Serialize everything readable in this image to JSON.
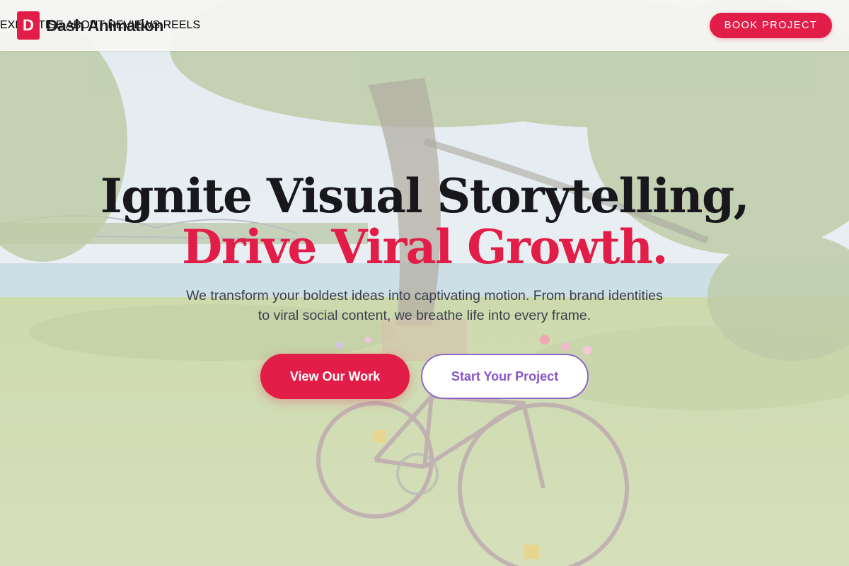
{
  "brand": {
    "logo_letter": "D",
    "name": "Dash Animation",
    "accent": "#e11d48"
  },
  "nav": {
    "items": [
      {
        "label": "EXPERTISE"
      },
      {
        "label": "ABOUT"
      },
      {
        "label": "REVIEWS"
      },
      {
        "label": "REELS"
      }
    ],
    "cta_label": "BOOK PROJECT"
  },
  "hero": {
    "title_line1": "Ignite Visual Storytelling,",
    "title_line2": "Drive Viral Growth.",
    "subtitle": "We transform your boldest ideas into captivating motion. From brand identities to viral social content, we breathe life into every frame.",
    "primary_button": "View Our Work",
    "secondary_button": "Start Your Project",
    "secondary_color": "#8856c4"
  },
  "background": {
    "description_icon": "landscape-bicycle-photo"
  }
}
